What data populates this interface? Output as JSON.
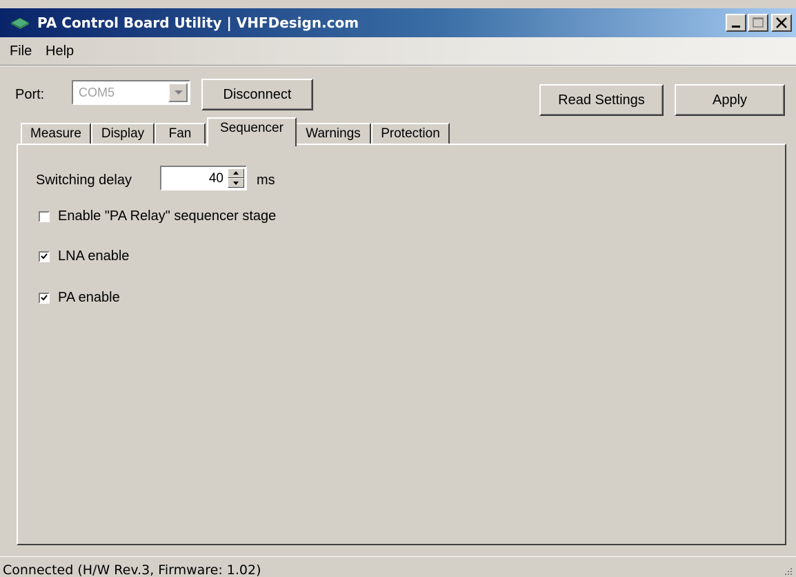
{
  "window": {
    "title": "PA Control Board Utility | VHFDesign.com"
  },
  "menu": {
    "file": "File",
    "help": "Help"
  },
  "port": {
    "label": "Port:",
    "value": "COM5",
    "disconnect_label": "Disconnect"
  },
  "toolbar": {
    "read_settings_label": "Read Settings",
    "apply_label": "Apply"
  },
  "tabs": [
    {
      "label": "Measure",
      "active": false
    },
    {
      "label": "Display",
      "active": false
    },
    {
      "label": "Fan",
      "active": false
    },
    {
      "label": "Sequencer",
      "active": true
    },
    {
      "label": "Warnings",
      "active": false
    },
    {
      "label": "Protection",
      "active": false
    }
  ],
  "sequencer": {
    "switching_delay_label": "Switching delay",
    "switching_delay_value": "40",
    "switching_delay_unit": "ms",
    "options": [
      {
        "label": "Enable \"PA Relay\" sequencer stage",
        "checked": false
      },
      {
        "label": "LNA enable",
        "checked": true
      },
      {
        "label": "PA enable",
        "checked": true
      }
    ]
  },
  "status": {
    "text": "Connected (H/W Rev.3, Firmware: 1.02)"
  },
  "colors": {
    "title_gradient_start": "#0a246a",
    "title_gradient_end": "#a6caf0",
    "face": "#d4d0c8"
  },
  "icons": {
    "app": "app-board-icon",
    "minimize": "minimize-icon",
    "maximize": "maximize-icon",
    "close": "close-icon",
    "check": "check-icon",
    "grip": "resize-grip-icon"
  }
}
